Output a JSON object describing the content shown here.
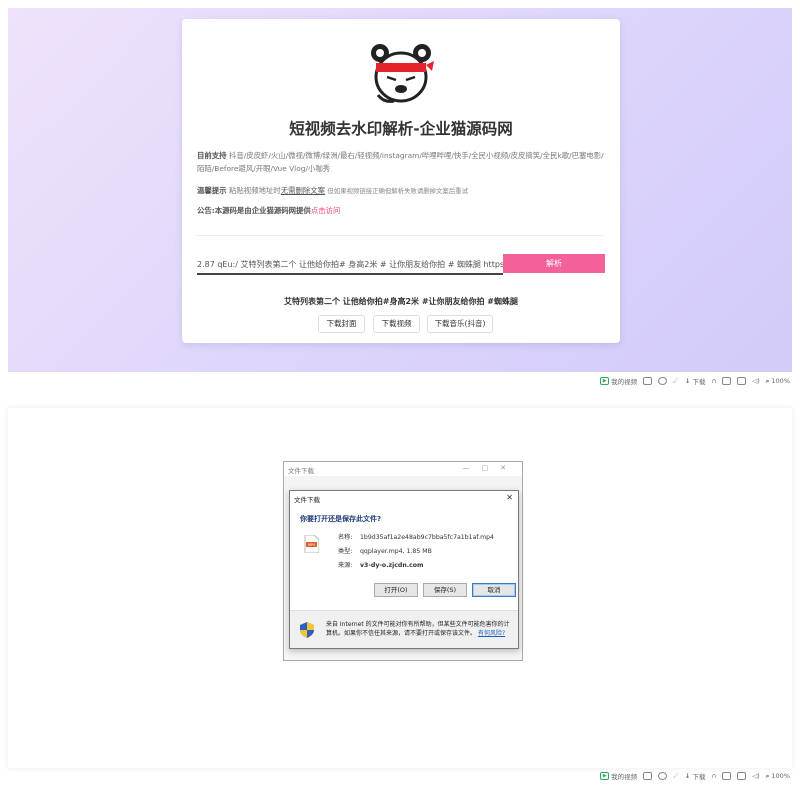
{
  "top": {
    "site_title": "短视频去水印解析-企业猫源码网",
    "support_label": "目前支持",
    "support_text": "抖音/皮皮虾/火山/微视/微博/绿洲/最右/轻视频/instagram/哔哩哔哩/快手/全民小视频/皮皮搞笑/全民k歌/巴塞电影/陌陌/Before避风/开眼/Vue Vlog/小咖秀",
    "tip_label": "温馨提示",
    "tip_text_1": "粘贴视频地址时",
    "tip_text_2": "无需删除文案",
    "tip_text_small": "但如果视频链接正确但解析失败请删掉文案后重试",
    "notice_text": "公告:本源码是由企业猫源码网提供",
    "notice_link": "点击访问",
    "input_value": "2.87 qEu:/ 艾特列表第二个 让他给你拍# 身高2米 # 让你朋友给你拍 # 蜘蛛腿 https://v.do",
    "parse_button": "解析",
    "video_title": "艾特列表第二个 让他给你拍#身高2米 #让你朋友给你拍 #蜘蛛腿",
    "buttons": [
      "下载封面",
      "下载视频",
      "下载音乐(抖音)"
    ],
    "accent_color": "#f4609a"
  },
  "statusbar": {
    "items": [
      "我的视频",
      "下载",
      "100%"
    ]
  },
  "dialog": {
    "back_title": "文件下载",
    "title": "文件下载",
    "question": "你要打开还是保存此文件?",
    "name_label": "名称:",
    "name_value": "1b9d35af1a2e48ab9c7bba5fc7a1b1af.mp4",
    "type_label": "类型:",
    "type_value": "qqplayer.mp4, 1.85 MB",
    "source_label": "来源:",
    "source_value": "v3-dy-o.zjcdn.com",
    "open_button": "打开(O)",
    "save_button": "保存(S)",
    "cancel_button": "取消",
    "warning_text": "来自 Internet 的文件可能对你有所帮助，但某些文件可能危害你的计算机。如果你不信任其来源，请不要打开或保存该文件。",
    "warning_link": "有何风险?"
  }
}
